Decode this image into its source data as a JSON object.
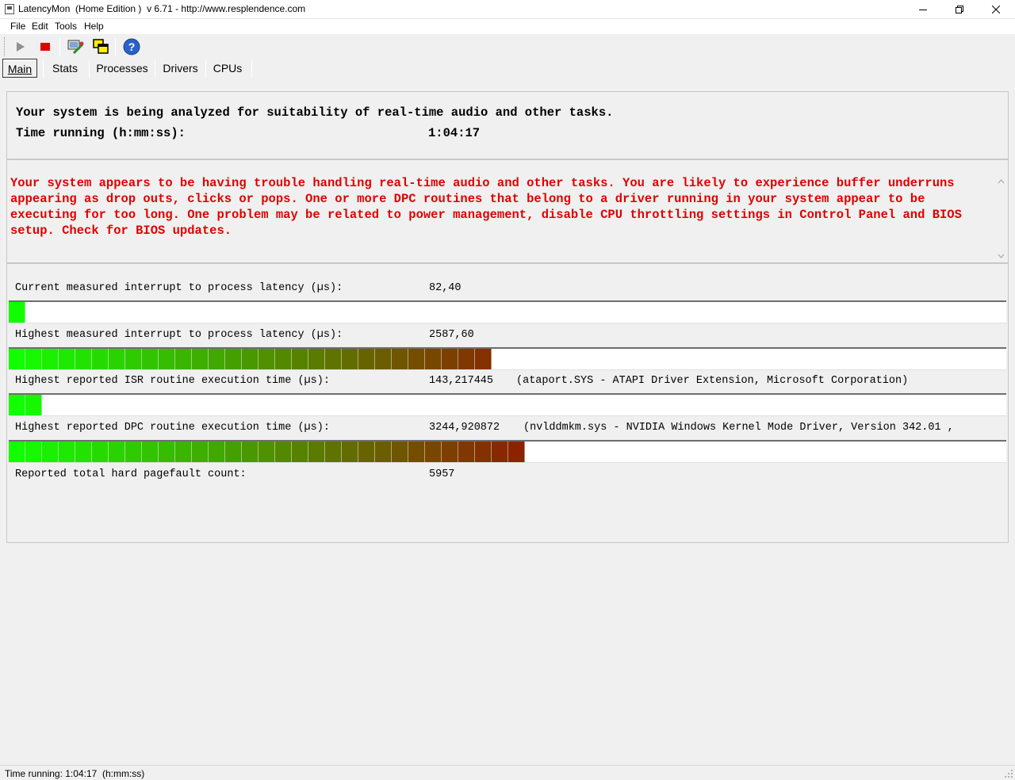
{
  "window": {
    "title": "LatencyMon  (Home Edition )  v 6.71 - http://www.resplendence.com",
    "icons": [
      "app-icon",
      "minimize-icon",
      "restore-icon",
      "close-icon"
    ]
  },
  "menu": {
    "items": [
      {
        "label": "File"
      },
      {
        "label": "Edit"
      },
      {
        "label": "Tools"
      },
      {
        "label": "Help"
      }
    ]
  },
  "toolbar": {
    "buttons": [
      {
        "name": "start",
        "icon": "play-icon"
      },
      {
        "name": "stop",
        "icon": "stop-icon"
      },
      {
        "name": "tool",
        "icon": "wrench-icon"
      },
      {
        "name": "windows",
        "icon": "windows-icon"
      },
      {
        "name": "help",
        "icon": "help-icon"
      }
    ],
    "colors": {
      "play": "#909090",
      "stop": "#e00000",
      "help": "#2a62c8"
    }
  },
  "tabs": [
    {
      "label": "Main",
      "active": true
    },
    {
      "label": "Stats",
      "active": false
    },
    {
      "label": "Processes",
      "active": false
    },
    {
      "label": "Drivers",
      "active": false
    },
    {
      "label": "CPUs",
      "active": false
    }
  ],
  "summary": {
    "line1": "Your system is being analyzed for suitability of real-time audio and other tasks.",
    "time_label": "Time running (h:mm:ss):",
    "time_value": "1:04:17"
  },
  "warning": {
    "text": "Your system appears to be having trouble handling real-time audio and other tasks. You are likely to experience buffer underruns appearing as drop outs, clicks or pops. One or more DPC routines that belong to a driver running in your system appear to be executing for too long. One problem may be related to power management, disable CPU throttling settings in Control Panel and BIOS setup. Check for BIOS updates.",
    "color": "#e00000"
  },
  "measurements": [
    {
      "label": "Current measured interrupt to process latency (µs):",
      "value": "82,40",
      "extra": "",
      "bar_segments": 1
    },
    {
      "label": "Highest measured interrupt to process latency (µs):",
      "value": "2587,60",
      "extra": "",
      "bar_segments": 29
    },
    {
      "label": "Highest reported ISR routine execution time (µs):",
      "value": "143,217445",
      "extra": "(ataport.SYS - ATAPI Driver Extension, Microsoft Corporation)",
      "bar_segments": 2
    },
    {
      "label": "Highest reported DPC routine execution time (µs):",
      "value": "3244,920872",
      "extra": "(nvlddmkm.sys - NVIDIA Windows Kernel Mode Driver, Version 342.01 ,",
      "bar_segments": 31
    },
    {
      "label": "Reported total hard pagefault count:",
      "value": "5957",
      "extra": ""
    }
  ],
  "bar_colors": {
    "start": "#12ff00",
    "end": "#8b2200"
  },
  "status": {
    "text": "Time running: 1:04:17  (h:mm:ss)"
  }
}
